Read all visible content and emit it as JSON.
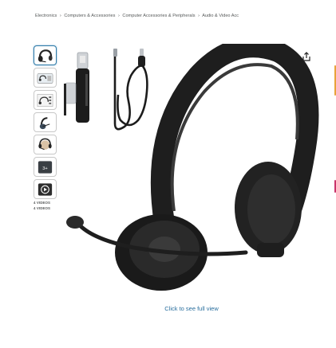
{
  "breadcrumb": {
    "items": [
      "Electronics",
      "Computers & Accessories",
      "Computer Accessories & Peripherals",
      "Audio & Video Acc"
    ],
    "separator": "›"
  },
  "thumbnails": {
    "items": [
      {
        "icon": "headset-icon",
        "active": true
      },
      {
        "icon": "product-box-icon",
        "active": false
      },
      {
        "icon": "specs-chart-icon",
        "active": false
      },
      {
        "icon": "headset-side-icon",
        "active": false
      },
      {
        "icon": "headset-worn-icon",
        "active": false
      },
      {
        "icon": "plus-count-icon",
        "label": "3+",
        "active": false
      },
      {
        "icon": "video-play-icon",
        "active": false
      }
    ],
    "video_labels": [
      "4 VIDEOS",
      "4 VIDEOS"
    ]
  },
  "main": {
    "image_alt": "Black USB headset with boom microphone, USB-A to USB-C adapter and cable",
    "click_full_view": "Click to see full view"
  },
  "colors": {
    "accent_link": "#2a6f9e",
    "thumb_active_border": "#2e7aa8",
    "headset_body": "#1e1e1e",
    "edge_orange": "#e8a33a",
    "edge_pink": "#c9346b"
  }
}
